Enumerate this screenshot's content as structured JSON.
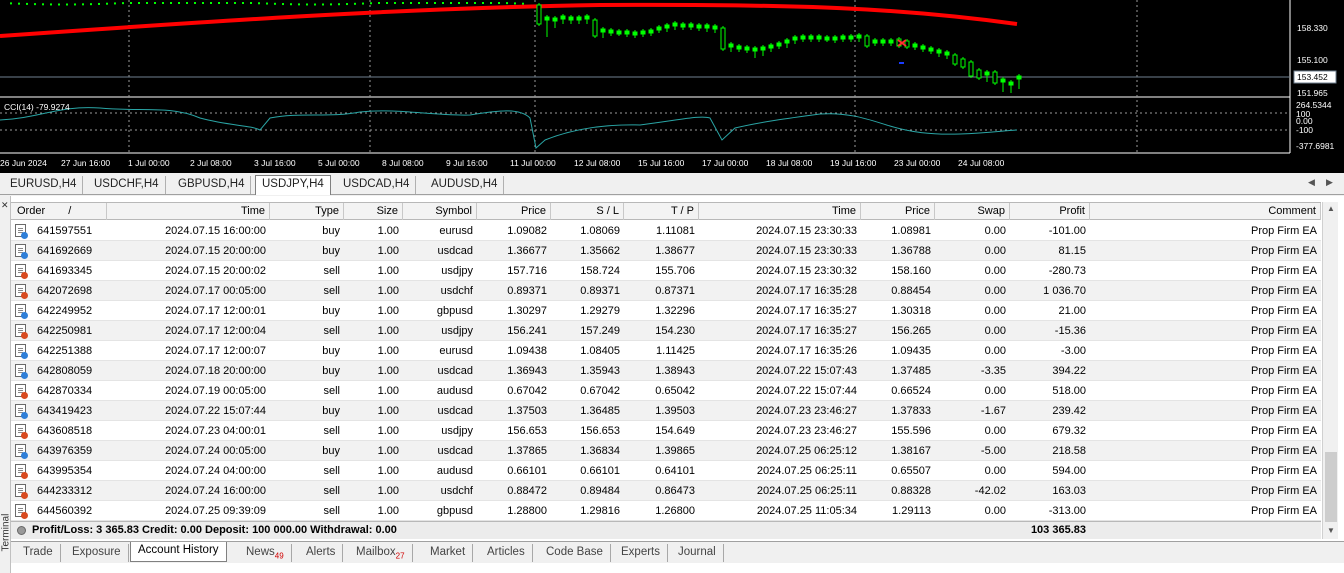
{
  "chart": {
    "price_axis": [
      "158.330",
      "155.100",
      "153.452",
      "151.965"
    ],
    "current_price": "153.452",
    "cci_label": "CCI(14) -79.9274",
    "cci_axis": [
      "264.5344",
      "100",
      "0.00",
      "-100",
      "-377.6981"
    ],
    "time_axis": [
      "26 Jun 2024",
      "27 Jun 16:00",
      "1 Jul 00:00",
      "2 Jul 08:00",
      "3 Jul 16:00",
      "5 Jul 00:00",
      "8 Jul 08:00",
      "9 Jul 16:00",
      "11 Jul 00:00",
      "12 Jul 08:00",
      "15 Jul 16:00",
      "17 Jul 00:00",
      "18 Jul 08:00",
      "19 Jul 16:00",
      "23 Jul 00:00",
      "24 Jul 08:00"
    ],
    "colors": {
      "bg": "#000000",
      "candle": "#00ff00",
      "ma": "#ff0000",
      "cci": "#2aa5a5",
      "bid": "#708090"
    }
  },
  "symbol_tabs": [
    "EURUSD,H4",
    "USDCHF,H4",
    "GBPUSD,H4",
    "USDJPY,H4",
    "USDCAD,H4",
    "AUDUSD,H4"
  ],
  "active_symbol_tab": "USDJPY,H4",
  "terminal": {
    "side_label": "Terminal",
    "columns": [
      "Order",
      "/",
      "Time",
      "Type",
      "Size",
      "Symbol",
      "Price",
      "S / L",
      "T / P",
      "Time",
      "Price",
      "Swap",
      "Profit",
      "Comment"
    ],
    "rows": [
      [
        "641597551",
        "2024.07.15 16:00:00",
        "buy",
        "1.00",
        "eurusd",
        "1.09082",
        "1.08069",
        "1.11081",
        "2024.07.15 23:30:33",
        "1.08981",
        "0.00",
        "-101.00",
        "Prop Firm EA"
      ],
      [
        "641692669",
        "2024.07.15 20:00:00",
        "buy",
        "1.00",
        "usdcad",
        "1.36677",
        "1.35662",
        "1.38677",
        "2024.07.15 23:30:33",
        "1.36788",
        "0.00",
        "81.15",
        "Prop Firm EA"
      ],
      [
        "641693345",
        "2024.07.15 20:00:02",
        "sell",
        "1.00",
        "usdjpy",
        "157.716",
        "158.724",
        "155.706",
        "2024.07.15 23:30:32",
        "158.160",
        "0.00",
        "-280.73",
        "Prop Firm EA"
      ],
      [
        "642072698",
        "2024.07.17 00:05:00",
        "sell",
        "1.00",
        "usdchf",
        "0.89371",
        "0.89371",
        "0.87371",
        "2024.07.17 16:35:28",
        "0.88454",
        "0.00",
        "1 036.70",
        "Prop Firm EA"
      ],
      [
        "642249952",
        "2024.07.17 12:00:01",
        "buy",
        "1.00",
        "gbpusd",
        "1.30297",
        "1.29279",
        "1.32296",
        "2024.07.17 16:35:27",
        "1.30318",
        "0.00",
        "21.00",
        "Prop Firm EA"
      ],
      [
        "642250981",
        "2024.07.17 12:00:04",
        "sell",
        "1.00",
        "usdjpy",
        "156.241",
        "157.249",
        "154.230",
        "2024.07.17 16:35:27",
        "156.265",
        "0.00",
        "-15.36",
        "Prop Firm EA"
      ],
      [
        "642251388",
        "2024.07.17 12:00:07",
        "buy",
        "1.00",
        "eurusd",
        "1.09438",
        "1.08405",
        "1.11425",
        "2024.07.17 16:35:26",
        "1.09435",
        "0.00",
        "-3.00",
        "Prop Firm EA"
      ],
      [
        "642808059",
        "2024.07.18 20:00:00",
        "buy",
        "1.00",
        "usdcad",
        "1.36943",
        "1.35943",
        "1.38943",
        "2024.07.22 15:07:43",
        "1.37485",
        "-3.35",
        "394.22",
        "Prop Firm EA"
      ],
      [
        "642870334",
        "2024.07.19 00:05:00",
        "sell",
        "1.00",
        "audusd",
        "0.67042",
        "0.67042",
        "0.65042",
        "2024.07.22 15:07:44",
        "0.66524",
        "0.00",
        "518.00",
        "Prop Firm EA"
      ],
      [
        "643419423",
        "2024.07.22 15:07:44",
        "buy",
        "1.00",
        "usdcad",
        "1.37503",
        "1.36485",
        "1.39503",
        "2024.07.23 23:46:27",
        "1.37833",
        "-1.67",
        "239.42",
        "Prop Firm EA"
      ],
      [
        "643608518",
        "2024.07.23 04:00:01",
        "sell",
        "1.00",
        "usdjpy",
        "156.653",
        "156.653",
        "154.649",
        "2024.07.23 23:46:27",
        "155.596",
        "0.00",
        "679.32",
        "Prop Firm EA"
      ],
      [
        "643976359",
        "2024.07.24 00:05:00",
        "buy",
        "1.00",
        "usdcad",
        "1.37865",
        "1.36834",
        "1.39865",
        "2024.07.25 06:25:12",
        "1.38167",
        "-5.00",
        "218.58",
        "Prop Firm EA"
      ],
      [
        "643995354",
        "2024.07.24 04:00:00",
        "sell",
        "1.00",
        "audusd",
        "0.66101",
        "0.66101",
        "0.64101",
        "2024.07.25 06:25:11",
        "0.65507",
        "0.00",
        "594.00",
        "Prop Firm EA"
      ],
      [
        "644233312",
        "2024.07.24 16:00:00",
        "sell",
        "1.00",
        "usdchf",
        "0.88472",
        "0.89484",
        "0.86473",
        "2024.07.25 06:25:11",
        "0.88328",
        "-42.02",
        "163.03",
        "Prop Firm EA"
      ],
      [
        "644560392",
        "2024.07.25 09:39:09",
        "sell",
        "1.00",
        "gbpusd",
        "1.28800",
        "1.29816",
        "1.26800",
        "2024.07.25 11:05:34",
        "1.29113",
        "0.00",
        "-313.00",
        "Prop Firm EA"
      ]
    ],
    "summary": "Profit/Loss: 3 365.83  Credit: 0.00  Deposit: 100 000.00  Withdrawal: 0.00",
    "balance": "103 365.83"
  },
  "bottom_tabs": [
    {
      "label": "Trade",
      "badge": ""
    },
    {
      "label": "Exposure",
      "badge": ""
    },
    {
      "label": "Account History",
      "badge": ""
    },
    {
      "label": "News",
      "badge": "49"
    },
    {
      "label": "Alerts",
      "badge": ""
    },
    {
      "label": "Mailbox",
      "badge": "27"
    },
    {
      "label": "Market",
      "badge": ""
    },
    {
      "label": "Articles",
      "badge": ""
    },
    {
      "label": "Code Base",
      "badge": ""
    },
    {
      "label": "Experts",
      "badge": ""
    },
    {
      "label": "Journal",
      "badge": ""
    }
  ],
  "active_bottom_tab": "Account History",
  "icon_colors": {
    "buy": "#2f7fd8",
    "sell": "#d84a1f"
  }
}
